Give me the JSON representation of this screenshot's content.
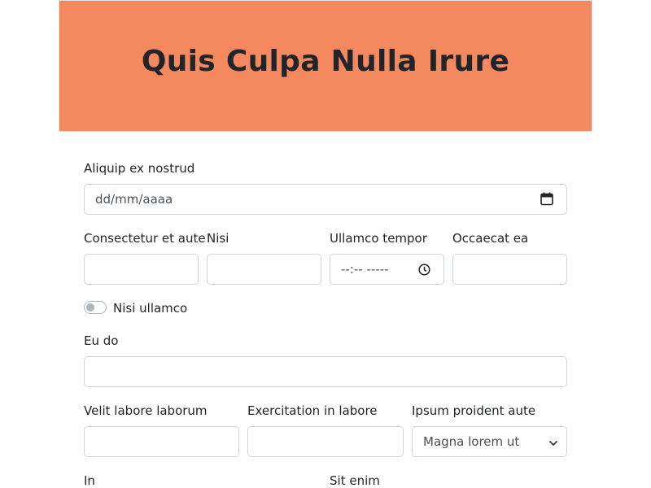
{
  "header": {
    "title": "Quis Culpa Nulla Irure",
    "background": "#f4885e"
  },
  "form": {
    "date_field": {
      "label": "Aliquip ex nostrud",
      "placeholder": "dd/mm/aaaa"
    },
    "row2": {
      "field1": {
        "label": "Consectetur et aute",
        "value": ""
      },
      "field2": {
        "label": "Nisi",
        "value": ""
      },
      "time_field": {
        "label": "Ullamco tempor",
        "placeholder": "--:-- -----"
      },
      "field4": {
        "label": "Occaecat ea",
        "value": ""
      }
    },
    "toggle": {
      "label": "Nisi ullamco",
      "checked": false
    },
    "eu_do": {
      "label": "Eu do",
      "value": ""
    },
    "row4": {
      "field1": {
        "label": "Velit labore laborum",
        "value": ""
      },
      "field2": {
        "label": "Exercitation in labore",
        "value": ""
      },
      "select": {
        "label": "Ipsum proident aute",
        "selected": "Magna lorem ut"
      }
    },
    "row5": {
      "field1": {
        "label": "In"
      },
      "field2": {
        "label": "Sit enim"
      }
    }
  },
  "icons": {
    "calendar": "calendar-icon",
    "clock": "clock-icon",
    "chevron": "chevron-down-icon"
  }
}
